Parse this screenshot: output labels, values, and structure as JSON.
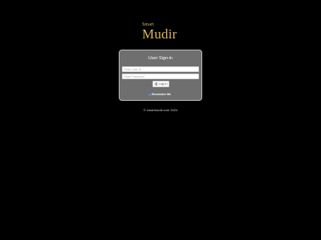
{
  "branding": {
    "small_text": "Smart",
    "main_text": "Mudir",
    "color": "#d9b65b"
  },
  "login_panel": {
    "title": "User Sign-in",
    "username_placeholder": "Enter User ID",
    "password_placeholder": "Enter Password",
    "login_button_label": "Log In",
    "login_button_icon": "login-icon",
    "remember_label": "Remember Me",
    "remember_checked": true
  },
  "footer": {
    "text": "© smartmudir.com 2024"
  },
  "colors": {
    "background": "#000000",
    "panel_background": "#6f6f6f",
    "panel_border": "#bdbdbd",
    "accent": "#3b6fd3"
  }
}
